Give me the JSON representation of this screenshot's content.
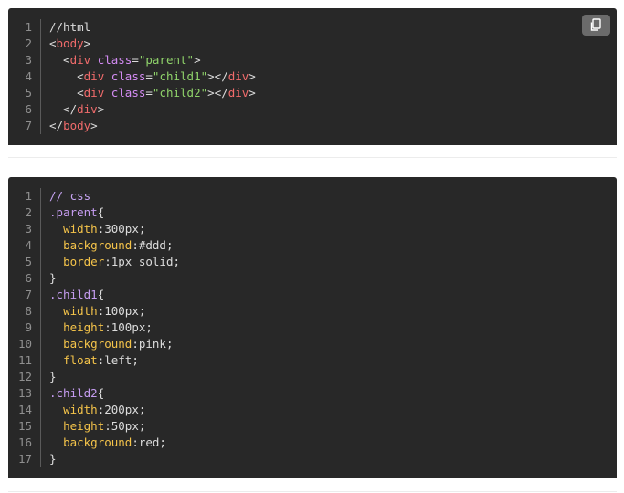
{
  "html_block": {
    "copy_icon": "copy-icon",
    "lines": [
      {
        "num": "1",
        "tokens": [
          {
            "t": "//html",
            "c": "t-plain"
          }
        ]
      },
      {
        "num": "2",
        "tokens": [
          {
            "t": "<",
            "c": "t-plain"
          },
          {
            "t": "body",
            "c": "t-tag"
          },
          {
            "t": ">",
            "c": "t-plain"
          }
        ]
      },
      {
        "num": "3",
        "tokens": [
          {
            "t": "  <",
            "c": "t-plain"
          },
          {
            "t": "div",
            "c": "t-tag"
          },
          {
            "t": " ",
            "c": "t-plain"
          },
          {
            "t": "class",
            "c": "t-attr"
          },
          {
            "t": "=",
            "c": "t-plain"
          },
          {
            "t": "\"parent\"",
            "c": "t-str"
          },
          {
            "t": ">",
            "c": "t-plain"
          }
        ]
      },
      {
        "num": "4",
        "tokens": [
          {
            "t": "    <",
            "c": "t-plain"
          },
          {
            "t": "div",
            "c": "t-tag"
          },
          {
            "t": " ",
            "c": "t-plain"
          },
          {
            "t": "class",
            "c": "t-attr"
          },
          {
            "t": "=",
            "c": "t-plain"
          },
          {
            "t": "\"child1\"",
            "c": "t-str"
          },
          {
            "t": "></",
            "c": "t-plain"
          },
          {
            "t": "div",
            "c": "t-tag"
          },
          {
            "t": ">",
            "c": "t-plain"
          }
        ]
      },
      {
        "num": "5",
        "tokens": [
          {
            "t": "    <",
            "c": "t-plain"
          },
          {
            "t": "div",
            "c": "t-tag"
          },
          {
            "t": " ",
            "c": "t-plain"
          },
          {
            "t": "class",
            "c": "t-attr"
          },
          {
            "t": "=",
            "c": "t-plain"
          },
          {
            "t": "\"child2\"",
            "c": "t-str"
          },
          {
            "t": "></",
            "c": "t-plain"
          },
          {
            "t": "div",
            "c": "t-tag"
          },
          {
            "t": ">",
            "c": "t-plain"
          }
        ]
      },
      {
        "num": "6",
        "tokens": [
          {
            "t": "  </",
            "c": "t-plain"
          },
          {
            "t": "div",
            "c": "t-tag"
          },
          {
            "t": ">",
            "c": "t-plain"
          }
        ]
      },
      {
        "num": "7",
        "tokens": [
          {
            "t": "</",
            "c": "t-plain"
          },
          {
            "t": "body",
            "c": "t-tag"
          },
          {
            "t": ">",
            "c": "t-plain"
          }
        ]
      }
    ]
  },
  "css_block": {
    "lines": [
      {
        "num": "1",
        "tokens": [
          {
            "t": "// css",
            "c": "t-comment"
          }
        ]
      },
      {
        "num": "2",
        "tokens": [
          {
            "t": ".parent",
            "c": "t-sel"
          },
          {
            "t": "{",
            "c": "t-plain"
          }
        ]
      },
      {
        "num": "3",
        "tokens": [
          {
            "t": "  ",
            "c": "t-plain"
          },
          {
            "t": "width",
            "c": "t-prop"
          },
          {
            "t": ":300px;",
            "c": "t-plain"
          }
        ]
      },
      {
        "num": "4",
        "tokens": [
          {
            "t": "  ",
            "c": "t-plain"
          },
          {
            "t": "background",
            "c": "t-prop"
          },
          {
            "t": ":#ddd;",
            "c": "t-plain"
          }
        ]
      },
      {
        "num": "5",
        "tokens": [
          {
            "t": "  ",
            "c": "t-plain"
          },
          {
            "t": "border",
            "c": "t-prop"
          },
          {
            "t": ":1px solid;",
            "c": "t-plain"
          }
        ]
      },
      {
        "num": "6",
        "tokens": [
          {
            "t": "}",
            "c": "t-plain"
          }
        ]
      },
      {
        "num": "7",
        "tokens": [
          {
            "t": ".child1",
            "c": "t-sel"
          },
          {
            "t": "{",
            "c": "t-plain"
          }
        ]
      },
      {
        "num": "8",
        "tokens": [
          {
            "t": "  ",
            "c": "t-plain"
          },
          {
            "t": "width",
            "c": "t-prop"
          },
          {
            "t": ":100px;",
            "c": "t-plain"
          }
        ]
      },
      {
        "num": "9",
        "tokens": [
          {
            "t": "  ",
            "c": "t-plain"
          },
          {
            "t": "height",
            "c": "t-prop"
          },
          {
            "t": ":100px;",
            "c": "t-plain"
          }
        ]
      },
      {
        "num": "10",
        "tokens": [
          {
            "t": "  ",
            "c": "t-plain"
          },
          {
            "t": "background",
            "c": "t-prop"
          },
          {
            "t": ":pink;",
            "c": "t-plain"
          }
        ]
      },
      {
        "num": "11",
        "tokens": [
          {
            "t": "  ",
            "c": "t-plain"
          },
          {
            "t": "float",
            "c": "t-prop"
          },
          {
            "t": ":left;",
            "c": "t-plain"
          }
        ]
      },
      {
        "num": "12",
        "tokens": [
          {
            "t": "}",
            "c": "t-plain"
          }
        ]
      },
      {
        "num": "13",
        "tokens": [
          {
            "t": ".child2",
            "c": "t-sel"
          },
          {
            "t": "{",
            "c": "t-plain"
          }
        ]
      },
      {
        "num": "14",
        "tokens": [
          {
            "t": "  ",
            "c": "t-plain"
          },
          {
            "t": "width",
            "c": "t-prop"
          },
          {
            "t": ":200px;",
            "c": "t-plain"
          }
        ]
      },
      {
        "num": "15",
        "tokens": [
          {
            "t": "  ",
            "c": "t-plain"
          },
          {
            "t": "height",
            "c": "t-prop"
          },
          {
            "t": ":50px;",
            "c": "t-plain"
          }
        ]
      },
      {
        "num": "16",
        "tokens": [
          {
            "t": "  ",
            "c": "t-plain"
          },
          {
            "t": "background",
            "c": "t-prop"
          },
          {
            "t": ":red;",
            "c": "t-plain"
          }
        ]
      },
      {
        "num": "17",
        "tokens": [
          {
            "t": "}",
            "c": "t-plain"
          }
        ]
      }
    ]
  },
  "colors": {
    "code_bg": "#282828",
    "tag": "#f06b6b",
    "attr": "#d48cf4",
    "string": "#8fd36a",
    "property": "#f5c44a",
    "selector": "#c59cf0"
  }
}
